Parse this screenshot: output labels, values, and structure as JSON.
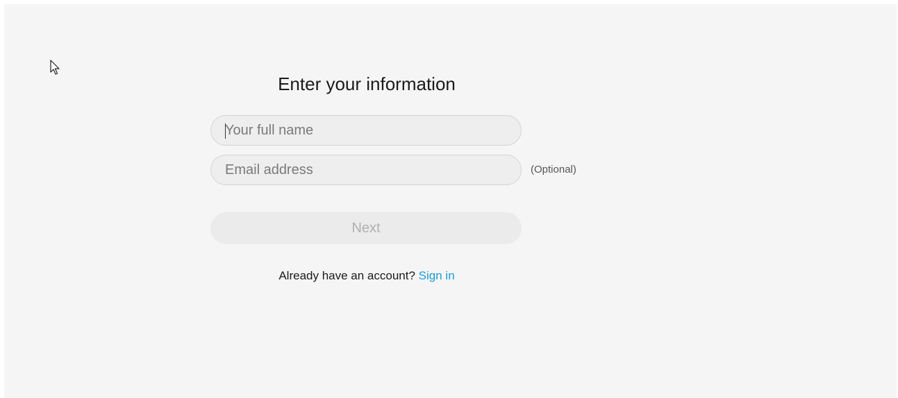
{
  "form": {
    "title": "Enter your information",
    "name_field": {
      "placeholder": "Your full name",
      "value": ""
    },
    "email_field": {
      "placeholder": "Email address",
      "value": "",
      "optional_label": "(Optional)"
    },
    "next_label": "Next",
    "account_prompt": "Already have an account?",
    "sign_in_label": "Sign in"
  },
  "colors": {
    "background": "#f5f5f5",
    "link": "#1a9bd7",
    "button_disabled_bg": "#ebebeb",
    "button_disabled_text": "#b0b0b0"
  },
  "icons": {
    "cursor": "mouse-pointer-icon"
  }
}
